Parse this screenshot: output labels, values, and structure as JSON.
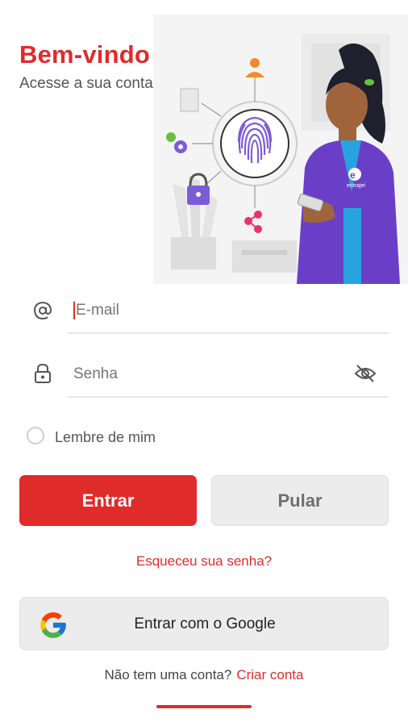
{
  "header": {
    "title": "Bem-vindo",
    "subtitle": "Acesse a sua conta"
  },
  "hero": {
    "badge_text": "entrajei",
    "colors": {
      "fingerprint": "#7b5cd6",
      "shirt": "#6a3fc8",
      "accent": "#e02b2b"
    }
  },
  "form": {
    "email": {
      "placeholder": "E-mail",
      "value": "",
      "icon": "at-icon"
    },
    "password": {
      "placeholder": "Senha",
      "value": "",
      "icon": "lock-icon",
      "toggle_icon": "eye-off-icon"
    },
    "remember_label": "Lembre de mim",
    "remember_checked": false
  },
  "actions": {
    "login_label": "Entrar",
    "skip_label": "Pular",
    "forgot_label": "Esqueceu sua senha?",
    "google_label": "Entrar com o Google"
  },
  "footer": {
    "no_account_text": "Não tem uma conta?",
    "create_account_label": "Criar conta"
  },
  "theme": {
    "primary": "#e02b2b",
    "secondary_bg": "#ececec"
  }
}
